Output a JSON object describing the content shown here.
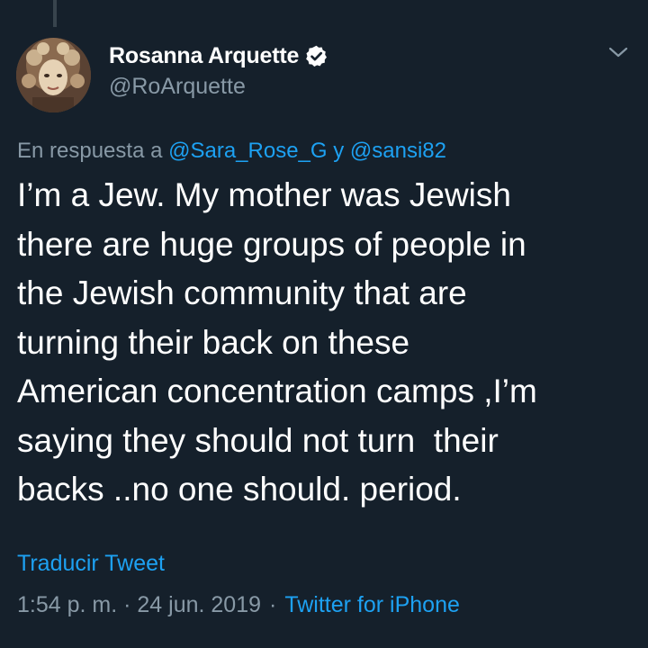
{
  "tweet": {
    "author": {
      "display_name": "Rosanna Arquette",
      "handle": "@RoArquette",
      "verified": true
    },
    "reply_to": {
      "prefix": "En respuesta a",
      "mention_1": "@Sara_Rose_G",
      "joiner": "y",
      "mention_2": "@sansi82"
    },
    "text": "I’m a Jew. My mother was Jewish\nthere are huge groups of people in\nthe Jewish community that are\nturning their back on these\nAmerican concentration camps ,I’m\nsaying they should not turn  their\nbacks ..no one should. period.",
    "translate_label": "Traducir Tweet",
    "timestamp": "1:54 p. m. · 24 jun. 2019",
    "separator": "·",
    "source": "Twitter for iPhone"
  },
  "icons": {
    "verified": "verified-badge-icon",
    "menu": "chevron-down-icon"
  },
  "colors": {
    "background": "#15202b",
    "text_primary": "#ffffff",
    "text_secondary": "#8899a6",
    "accent": "#1da1f2"
  }
}
